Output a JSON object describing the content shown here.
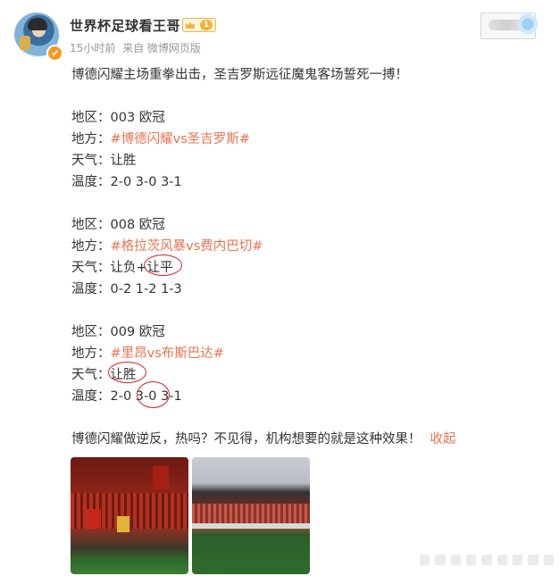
{
  "post": {
    "username": "世界杯足球看王哥",
    "level": "1",
    "time": "15小时前",
    "source": "来自 微博网页版",
    "intro": "博德闪耀主场重拳出击，圣吉罗斯远征魔鬼客场誓死一搏！",
    "blocks": [
      {
        "region_label": "地区：",
        "region_value": "003  欧冠",
        "place_label": "地方：",
        "place_tag": "#博德闪耀vs圣吉罗斯#",
        "weather_label": "天气：",
        "weather_value": "让胜",
        "temp_label": "温度：",
        "temp_value": "2-0  3-0  3-1"
      },
      {
        "region_label": "地区：",
        "region_value": "008  欧冠",
        "place_label": "地方：",
        "place_tag": "#格拉茨风暴vs费内巴切#",
        "weather_label": "天气：",
        "weather_value": "让负+让平",
        "temp_label": "温度：",
        "temp_value": "0-2  1-2  1-3"
      },
      {
        "region_label": "地区：",
        "region_value": "009  欧冠",
        "place_label": "地方：",
        "place_tag": "#里昂vs布斯巴达#",
        "weather_label": "天气：",
        "weather_value": "让胜",
        "temp_label": "温度：",
        "temp_value": "2-0  3-0  3-1"
      }
    ],
    "closing": "博德闪耀做逆反，热吗？不见得，机构想要的就是这种效果！",
    "fold_label": "收起"
  },
  "colors": {
    "tag": "#eb7350",
    "annotation": "#d6202a",
    "meta": "#999999"
  },
  "icons": [
    "verified-badge-icon",
    "crown-icon"
  ]
}
